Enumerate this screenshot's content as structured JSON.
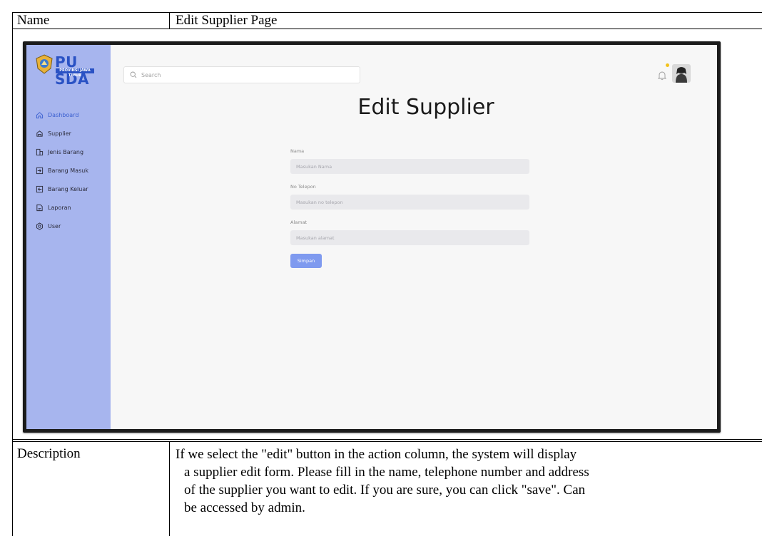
{
  "doc": {
    "name_label": "Name",
    "name_value": "Edit Supplier Page",
    "description_label": "Description",
    "description_lines": [
      "If we select the \"edit\" button in the action column, the system will display",
      "a supplier edit form. Please fill in the name, telephone number and address",
      "of the supplier you want to edit. If you are sure, you can click \"save\". Can",
      "be accessed by admin."
    ]
  },
  "app": {
    "logo": {
      "main": "PU SDA",
      "sub": "PROVINSI JAWA TIMUR"
    },
    "search_placeholder": "Search",
    "sidebar": [
      {
        "label": "Dashboard",
        "icon": "home-icon",
        "active": true
      },
      {
        "label": "Supplier",
        "icon": "supplier-icon"
      },
      {
        "label": "Jenis Barang",
        "icon": "category-icon"
      },
      {
        "label": "Barang Masuk",
        "icon": "incoming-icon"
      },
      {
        "label": "Barang Keluar",
        "icon": "outgoing-icon"
      },
      {
        "label": "Laporan",
        "icon": "report-icon"
      },
      {
        "label": "User",
        "icon": "user-gear-icon"
      }
    ],
    "page_title": "Edit Supplier",
    "form": {
      "fields": [
        {
          "label": "Nama",
          "placeholder": "Masukan Nama"
        },
        {
          "label": "No Telepon",
          "placeholder": "Masukan no telepon"
        },
        {
          "label": "Alamat",
          "placeholder": "Masukan alamat"
        }
      ],
      "submit_label": "Simpan"
    },
    "colors": {
      "sidebar": "#a7b5ee",
      "accent": "#7f9aef",
      "notification_dot": "#f3c21a"
    }
  }
}
